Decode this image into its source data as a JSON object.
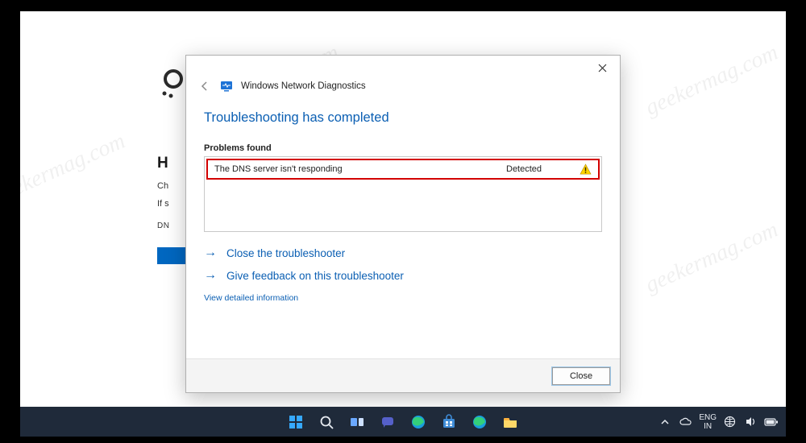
{
  "watermark_text": "geekermag.com",
  "background_page": {
    "heading_partial": "H",
    "line1_partial": "Ch",
    "line2_partial": "If s",
    "line3_partial": "DN"
  },
  "dialog": {
    "title": "Windows Network Diagnostics",
    "heading": "Troubleshooting has completed",
    "problems_label": "Problems found",
    "problems": [
      {
        "text": "The DNS server isn't responding",
        "status": "Detected",
        "severity": "warning"
      }
    ],
    "actions": {
      "close_troubleshooter": "Close the troubleshooter",
      "give_feedback": "Give feedback on this troubleshooter"
    },
    "detail_link": "View detailed information",
    "close_button": "Close"
  },
  "taskbar": {
    "items": [
      {
        "name": "start-icon",
        "label": "Start"
      },
      {
        "name": "search-icon",
        "label": "Search"
      },
      {
        "name": "taskview-icon",
        "label": "Task View"
      },
      {
        "name": "chat-icon",
        "label": "Chat"
      },
      {
        "name": "edge-icon",
        "label": "Edge"
      },
      {
        "name": "store-icon",
        "label": "Microsoft Store"
      },
      {
        "name": "edge2-icon",
        "label": "Edge"
      },
      {
        "name": "explorer-icon",
        "label": "File Explorer"
      }
    ],
    "tray": {
      "chevron": "^",
      "onedrive": "cloud",
      "lang_top": "ENG",
      "lang_bottom": "IN",
      "network": "globe",
      "volume": "volume",
      "battery": "battery"
    }
  }
}
